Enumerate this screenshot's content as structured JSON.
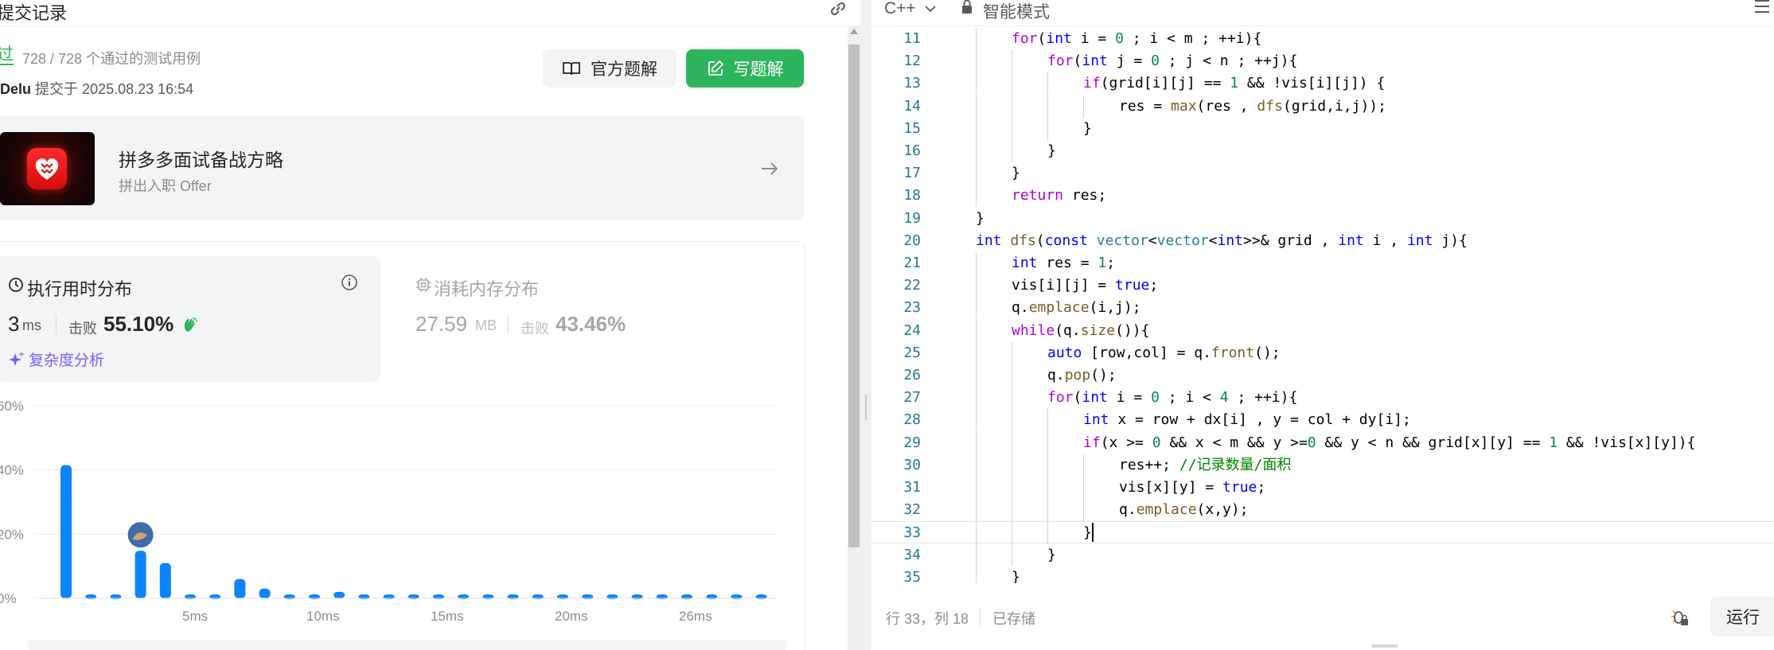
{
  "left_panel": {
    "header_title": "提交记录",
    "status": "过",
    "cases": "728 / 728 个通过的测试用例",
    "author": "Delu",
    "submitted_label": "提交于 2025.08.23 16:54",
    "official_solution_label": "官方题解",
    "write_solution_label": "写题解",
    "promo": {
      "title": "拼多多面试备战方略",
      "subtitle": "拼出入职 Offer"
    },
    "runtime": {
      "title": "执行用时分布",
      "value": "3",
      "unit": "ms",
      "beat_label": "击败",
      "beat": "55.10%",
      "complexity_label": "复杂度分析"
    },
    "memory": {
      "title": "消耗内存分布",
      "value": "27.59",
      "unit": "MB",
      "beat_label": "击败",
      "beat": "43.46%"
    }
  },
  "chart_data": {
    "type": "bar",
    "y_unit": "percent",
    "y_ticks": [
      "0%",
      "20%",
      "40%",
      "60%"
    ],
    "ylim": [
      0,
      60
    ],
    "x_ticks": [
      "5ms",
      "10ms",
      "15ms",
      "20ms",
      "26ms"
    ],
    "x_tick_positions": [
      5,
      10,
      15,
      20,
      25
    ],
    "values": [
      41.5,
      1.2,
      1.2,
      14.8,
      11,
      1.2,
      1.2,
      6,
      3,
      1.2,
      1.2,
      2,
      1.2,
      1.2,
      1.2,
      1.2,
      1.2,
      1.2,
      1.2,
      1.2,
      1.2,
      1.2,
      1.2,
      1.2,
      1.2,
      1.2,
      1.2,
      1.2,
      1.2
    ],
    "user_bar_index": 3,
    "bar_color": "#0a84ff",
    "grid": true
  },
  "editor": {
    "language": "C++",
    "mode": "智能模式",
    "status_position": "行 33，列 18",
    "status_saved": "已存储",
    "run_label": "运行",
    "lines": [
      {
        "no": "11",
        "indent": 2,
        "tokens": [
          [
            "ctl",
            "for"
          ],
          [
            "",
            "("
          ],
          [
            "kw",
            "int"
          ],
          [
            "",
            " i = "
          ],
          [
            "num",
            "0"
          ],
          [
            "",
            " ; i < m ; ++i){"
          ]
        ]
      },
      {
        "no": "12",
        "indent": 3,
        "tokens": [
          [
            "ctl",
            "for"
          ],
          [
            "",
            "("
          ],
          [
            "kw",
            "int"
          ],
          [
            "",
            " j = "
          ],
          [
            "num",
            "0"
          ],
          [
            "",
            " ; j < n ; ++j){"
          ]
        ]
      },
      {
        "no": "13",
        "indent": 4,
        "tokens": [
          [
            "ctl",
            "if"
          ],
          [
            "",
            "(grid[i][j] == "
          ],
          [
            "num",
            "1"
          ],
          [
            "",
            " && !vis[i][j]) {"
          ]
        ]
      },
      {
        "no": "14",
        "indent": 5,
        "tokens": [
          [
            "",
            "res = "
          ],
          [
            "fn",
            "max"
          ],
          [
            "",
            "(res , "
          ],
          [
            "fn",
            "dfs"
          ],
          [
            "",
            "(grid,i,j));"
          ]
        ]
      },
      {
        "no": "15",
        "indent": 4,
        "tokens": [
          [
            "",
            "}"
          ]
        ]
      },
      {
        "no": "16",
        "indent": 3,
        "tokens": [
          [
            "",
            "}"
          ]
        ]
      },
      {
        "no": "17",
        "indent": 2,
        "tokens": [
          [
            "",
            "}"
          ]
        ]
      },
      {
        "no": "18",
        "indent": 2,
        "tokens": [
          [
            "ctl",
            "return"
          ],
          [
            "",
            " res;"
          ]
        ]
      },
      {
        "no": "19",
        "indent": 1,
        "tokens": [
          [
            "",
            "}"
          ]
        ]
      },
      {
        "no": "20",
        "indent": 1,
        "tokens": [
          [
            "kw",
            "int"
          ],
          [
            "",
            " "
          ],
          [
            "fn",
            "dfs"
          ],
          [
            "",
            "("
          ],
          [
            "kw",
            "const"
          ],
          [
            "",
            " "
          ],
          [
            "ty",
            "vector"
          ],
          [
            "",
            "<"
          ],
          [
            "ty",
            "vector"
          ],
          [
            "",
            "<"
          ],
          [
            "kw",
            "int"
          ],
          [
            "",
            ">>& grid , "
          ],
          [
            "kw",
            "int"
          ],
          [
            "",
            " i , "
          ],
          [
            "kw",
            "int"
          ],
          [
            "",
            " j){"
          ]
        ]
      },
      {
        "no": "21",
        "indent": 2,
        "tokens": [
          [
            "kw",
            "int"
          ],
          [
            "",
            " res = "
          ],
          [
            "num",
            "1"
          ],
          [
            "",
            ";"
          ]
        ]
      },
      {
        "no": "22",
        "indent": 2,
        "tokens": [
          [
            "",
            "vis[i][j] = "
          ],
          [
            "kw",
            "true"
          ],
          [
            "",
            ";"
          ]
        ]
      },
      {
        "no": "23",
        "indent": 2,
        "tokens": [
          [
            "",
            "q."
          ],
          [
            "fn",
            "emplace"
          ],
          [
            "",
            "(i,j);"
          ]
        ]
      },
      {
        "no": "24",
        "indent": 2,
        "tokens": [
          [
            "ctl",
            "while"
          ],
          [
            "",
            "(q."
          ],
          [
            "fn",
            "size"
          ],
          [
            "",
            "()){"
          ]
        ]
      },
      {
        "no": "25",
        "indent": 3,
        "tokens": [
          [
            "kw",
            "auto"
          ],
          [
            "",
            " [row,col] = q."
          ],
          [
            "fn",
            "front"
          ],
          [
            "",
            "();"
          ]
        ]
      },
      {
        "no": "26",
        "indent": 3,
        "tokens": [
          [
            "",
            "q."
          ],
          [
            "fn",
            "pop"
          ],
          [
            "",
            "();"
          ]
        ]
      },
      {
        "no": "27",
        "indent": 3,
        "tokens": [
          [
            "ctl",
            "for"
          ],
          [
            "",
            "("
          ],
          [
            "kw",
            "int"
          ],
          [
            "",
            " i = "
          ],
          [
            "num",
            "0"
          ],
          [
            "",
            " ; i < "
          ],
          [
            "num",
            "4"
          ],
          [
            "",
            " ; ++i){"
          ]
        ]
      },
      {
        "no": "28",
        "indent": 4,
        "tokens": [
          [
            "kw",
            "int"
          ],
          [
            "",
            " x = row + dx[i] , y = col + dy[i];"
          ]
        ]
      },
      {
        "no": "29",
        "indent": 4,
        "tokens": [
          [
            "ctl",
            "if"
          ],
          [
            "",
            "(x >= "
          ],
          [
            "num",
            "0"
          ],
          [
            "",
            " && x < m && y >="
          ],
          [
            "num",
            "0"
          ],
          [
            "",
            " && y < n && grid[x][y] == "
          ],
          [
            "num",
            "1"
          ],
          [
            "",
            " && !vis[x][y]){"
          ]
        ]
      },
      {
        "no": "30",
        "indent": 5,
        "tokens": [
          [
            "",
            "res++; "
          ],
          [
            "cm",
            "//记录数量/面积"
          ]
        ]
      },
      {
        "no": "31",
        "indent": 5,
        "tokens": [
          [
            "",
            "vis[x][y] = "
          ],
          [
            "kw",
            "true"
          ],
          [
            "",
            ";"
          ]
        ]
      },
      {
        "no": "32",
        "indent": 5,
        "tokens": [
          [
            "",
            "q."
          ],
          [
            "fn",
            "emplace"
          ],
          [
            "",
            "(x,y);"
          ]
        ]
      },
      {
        "no": "33",
        "indent": 4,
        "tokens": [
          [
            "",
            "}"
          ]
        ],
        "current": true
      },
      {
        "no": "34",
        "indent": 3,
        "tokens": [
          [
            "",
            "}"
          ]
        ]
      },
      {
        "no": "35",
        "indent": 2,
        "tokens": [
          [
            "",
            "}"
          ]
        ]
      }
    ]
  }
}
